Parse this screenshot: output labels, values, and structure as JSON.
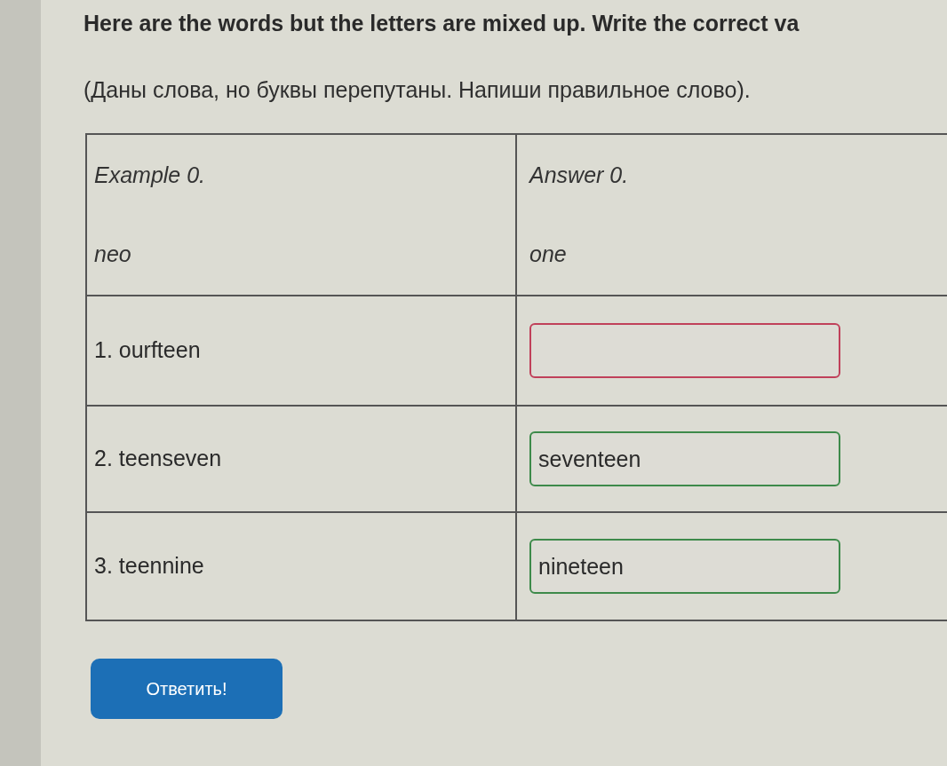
{
  "instruction": "Here are the words but the letters are mixed up. Write the correct va",
  "translation": "(Даны слова, но буквы перепутаны. Напиши правильное слово).",
  "example": {
    "label": "Example 0.",
    "word": "neo",
    "answer_label": "Answer 0.",
    "answer": "one"
  },
  "rows": [
    {
      "word": "1. ourfteen",
      "invalid": true
    },
    {
      "word": "2. teenseven",
      "value": "seventeen",
      "invalid": false
    },
    {
      "word": "3. teennine",
      "value": "nineteen",
      "invalid": false
    }
  ],
  "submit_button": "Ответить!"
}
